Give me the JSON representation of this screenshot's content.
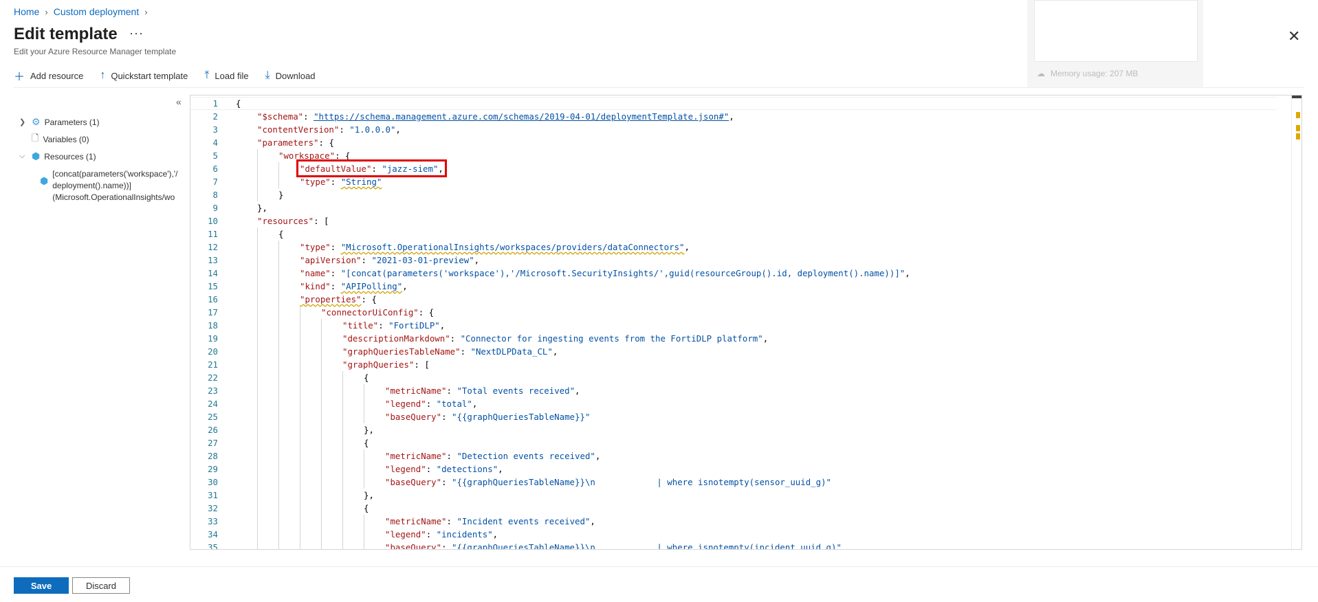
{
  "breadcrumb": {
    "home": "Home",
    "deployment": "Custom deployment"
  },
  "header": {
    "title": "Edit template",
    "more": "···",
    "subtitle": "Edit your Azure Resource Manager template"
  },
  "toolbar": {
    "add_resource": "Add resource",
    "quickstart": "Quickstart template",
    "load_file": "Load file",
    "download": "Download"
  },
  "overlay": {
    "memory": "Memory usage: 207 MB"
  },
  "tree": {
    "parameters": "Parameters (1)",
    "variables": "Variables (0)",
    "resources": "Resources (1)",
    "resource_line1": "[concat(parameters('workspace'),'/",
    "resource_line2": "deployment().name))]",
    "resource_line3": "(Microsoft.OperationalInsights/wo"
  },
  "editor": {
    "lines": [
      {
        "n": "1",
        "indent": 0,
        "parts": [
          [
            "p",
            "{"
          ]
        ]
      },
      {
        "n": "2",
        "indent": 1,
        "parts": [
          [
            "k",
            "\"$schema\""
          ],
          [
            "p",
            ": "
          ],
          [
            "s url",
            "\"https://schema.management.azure.com/schemas/2019-04-01/deploymentTemplate.json#\""
          ],
          [
            "p",
            ","
          ]
        ]
      },
      {
        "n": "3",
        "indent": 1,
        "parts": [
          [
            "k",
            "\"contentVersion\""
          ],
          [
            "p",
            ": "
          ],
          [
            "s",
            "\"1.0.0.0\""
          ],
          [
            "p",
            ","
          ]
        ]
      },
      {
        "n": "4",
        "indent": 1,
        "parts": [
          [
            "k",
            "\"parameters\""
          ],
          [
            "p",
            ": {"
          ]
        ]
      },
      {
        "n": "5",
        "indent": 2,
        "parts": [
          [
            "k",
            "\"workspace\""
          ],
          [
            "p",
            ": {"
          ]
        ]
      },
      {
        "n": "6",
        "indent": 3,
        "parts": [
          [
            "k",
            "\"defaultValue\""
          ],
          [
            "p",
            ": "
          ],
          [
            "s",
            "\"jazz-siem\""
          ],
          [
            "p",
            ","
          ]
        ]
      },
      {
        "n": "7",
        "indent": 3,
        "parts": [
          [
            "k",
            "\"type\""
          ],
          [
            "p",
            ": "
          ],
          [
            "s warn",
            "\"String\""
          ]
        ]
      },
      {
        "n": "8",
        "indent": 2,
        "parts": [
          [
            "p",
            "}"
          ]
        ]
      },
      {
        "n": "9",
        "indent": 1,
        "parts": [
          [
            "p",
            "},"
          ]
        ]
      },
      {
        "n": "10",
        "indent": 1,
        "parts": [
          [
            "k",
            "\"resources\""
          ],
          [
            "p",
            ": ["
          ]
        ]
      },
      {
        "n": "11",
        "indent": 2,
        "parts": [
          [
            "p",
            "{"
          ]
        ]
      },
      {
        "n": "12",
        "indent": 3,
        "parts": [
          [
            "k",
            "\"type\""
          ],
          [
            "p",
            ": "
          ],
          [
            "s warn",
            "\"Microsoft.OperationalInsights/workspaces/providers/dataConnectors\""
          ],
          [
            "p",
            ","
          ]
        ]
      },
      {
        "n": "13",
        "indent": 3,
        "parts": [
          [
            "k",
            "\"apiVersion\""
          ],
          [
            "p",
            ": "
          ],
          [
            "s",
            "\"2021-03-01-preview\""
          ],
          [
            "p",
            ","
          ]
        ]
      },
      {
        "n": "14",
        "indent": 3,
        "parts": [
          [
            "k",
            "\"name\""
          ],
          [
            "p",
            ": "
          ],
          [
            "s",
            "\"[concat(parameters('workspace'),'/Microsoft.SecurityInsights/',guid(resourceGroup().id, deployment().name))]\""
          ],
          [
            "p",
            ","
          ]
        ]
      },
      {
        "n": "15",
        "indent": 3,
        "parts": [
          [
            "k",
            "\"kind\""
          ],
          [
            "p",
            ": "
          ],
          [
            "s warn",
            "\"APIPolling\""
          ],
          [
            "p",
            ","
          ]
        ]
      },
      {
        "n": "16",
        "indent": 3,
        "parts": [
          [
            "k warn",
            "\"properties\""
          ],
          [
            "p",
            ": {"
          ]
        ]
      },
      {
        "n": "17",
        "indent": 4,
        "parts": [
          [
            "k",
            "\"connectorUiConfig\""
          ],
          [
            "p",
            ": {"
          ]
        ]
      },
      {
        "n": "18",
        "indent": 5,
        "parts": [
          [
            "k",
            "\"title\""
          ],
          [
            "p",
            ": "
          ],
          [
            "s",
            "\"FortiDLP\""
          ],
          [
            "p",
            ","
          ]
        ]
      },
      {
        "n": "19",
        "indent": 5,
        "parts": [
          [
            "k",
            "\"descriptionMarkdown\""
          ],
          [
            "p",
            ": "
          ],
          [
            "s",
            "\"Connector for ingesting events from the FortiDLP platform\""
          ],
          [
            "p",
            ","
          ]
        ]
      },
      {
        "n": "20",
        "indent": 5,
        "parts": [
          [
            "k",
            "\"graphQueriesTableName\""
          ],
          [
            "p",
            ": "
          ],
          [
            "s",
            "\"NextDLPData_CL\""
          ],
          [
            "p",
            ","
          ]
        ]
      },
      {
        "n": "21",
        "indent": 5,
        "parts": [
          [
            "k",
            "\"graphQueries\""
          ],
          [
            "p",
            ": ["
          ]
        ]
      },
      {
        "n": "22",
        "indent": 6,
        "parts": [
          [
            "p",
            "{"
          ]
        ]
      },
      {
        "n": "23",
        "indent": 7,
        "parts": [
          [
            "k",
            "\"metricName\""
          ],
          [
            "p",
            ": "
          ],
          [
            "s",
            "\"Total events received\""
          ],
          [
            "p",
            ","
          ]
        ]
      },
      {
        "n": "24",
        "indent": 7,
        "parts": [
          [
            "k",
            "\"legend\""
          ],
          [
            "p",
            ": "
          ],
          [
            "s",
            "\"total\""
          ],
          [
            "p",
            ","
          ]
        ]
      },
      {
        "n": "25",
        "indent": 7,
        "parts": [
          [
            "k",
            "\"baseQuery\""
          ],
          [
            "p",
            ": "
          ],
          [
            "s",
            "\"{{graphQueriesTableName}}\""
          ]
        ]
      },
      {
        "n": "26",
        "indent": 6,
        "parts": [
          [
            "p",
            "},"
          ]
        ]
      },
      {
        "n": "27",
        "indent": 6,
        "parts": [
          [
            "p",
            "{"
          ]
        ]
      },
      {
        "n": "28",
        "indent": 7,
        "parts": [
          [
            "k",
            "\"metricName\""
          ],
          [
            "p",
            ": "
          ],
          [
            "s",
            "\"Detection events received\""
          ],
          [
            "p",
            ","
          ]
        ]
      },
      {
        "n": "29",
        "indent": 7,
        "parts": [
          [
            "k",
            "\"legend\""
          ],
          [
            "p",
            ": "
          ],
          [
            "s",
            "\"detections\""
          ],
          [
            "p",
            ","
          ]
        ]
      },
      {
        "n": "30",
        "indent": 7,
        "parts": [
          [
            "k",
            "\"baseQuery\""
          ],
          [
            "p",
            ": "
          ],
          [
            "s",
            "\"{{graphQueriesTableName}}\\n            | where isnotempty(sensor_uuid_g)\""
          ]
        ]
      },
      {
        "n": "31",
        "indent": 6,
        "parts": [
          [
            "p",
            "},"
          ]
        ]
      },
      {
        "n": "32",
        "indent": 6,
        "parts": [
          [
            "p",
            "{"
          ]
        ]
      },
      {
        "n": "33",
        "indent": 7,
        "parts": [
          [
            "k",
            "\"metricName\""
          ],
          [
            "p",
            ": "
          ],
          [
            "s",
            "\"Incident events received\""
          ],
          [
            "p",
            ","
          ]
        ]
      },
      {
        "n": "34",
        "indent": 7,
        "parts": [
          [
            "k",
            "\"legend\""
          ],
          [
            "p",
            ": "
          ],
          [
            "s",
            "\"incidents\""
          ],
          [
            "p",
            ","
          ]
        ]
      },
      {
        "n": "35",
        "indent": 7,
        "parts": [
          [
            "k",
            "\"baseQuery\""
          ],
          [
            "p",
            ": "
          ],
          [
            "s",
            "\"{{graphQueriesTableName}}\\n            | where isnotempty(incident_uuid_g)\""
          ]
        ]
      }
    ]
  },
  "footer": {
    "save": "Save",
    "discard": "Discard"
  },
  "colors": {
    "accent": "#0f6cbd",
    "highlight_box": "#e00000",
    "json_key": "#a31515",
    "json_string": "#0451a5",
    "line_number": "#237893"
  }
}
